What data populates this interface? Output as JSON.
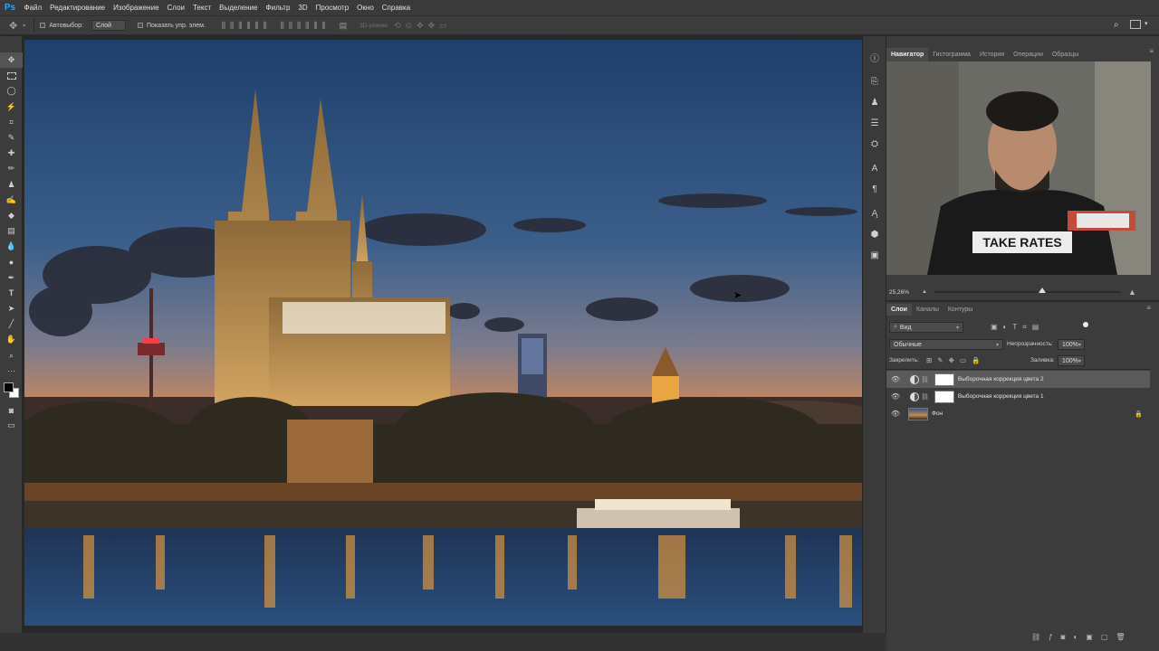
{
  "app": {
    "logo": "Ps"
  },
  "menu": [
    "Файл",
    "Редактирование",
    "Изображение",
    "Слои",
    "Текст",
    "Выделение",
    "Фильтр",
    "3D",
    "Просмотр",
    "Окно",
    "Справка"
  ],
  "options": {
    "autoselect_label": "Автовыбор:",
    "autoselect_value": "Слой",
    "show_controls_label": "Показать упр. элем.",
    "mode3d_label": "3D-режим:"
  },
  "navigator": {
    "tabs": [
      "Навигатор",
      "Гистограмма",
      "История",
      "Операции",
      "Образцы"
    ],
    "zoom": "25,26%",
    "slider_level": 0.58,
    "shirt_text": "TAKE RATES"
  },
  "layers_panel": {
    "tabs": [
      "Слои",
      "Каналы",
      "Контуры"
    ],
    "filter_kind": "Вид",
    "blend_mode": "Обычные",
    "opacity_label": "Непрозрачность:",
    "opacity_value": "100%",
    "lock_label": "Закрепить:",
    "fill_label": "Заливка:",
    "fill_value": "100%",
    "layers": [
      {
        "name": "Выборочная коррекция цвета 2",
        "selected": true
      },
      {
        "name": "Выборочная коррекция цвета 1",
        "selected": false
      },
      {
        "name": "Фон",
        "selected": false
      }
    ]
  },
  "colors": {
    "ps_blue": "#2fa3f7",
    "panel_bg": "#3c3c3c",
    "workspace_bg": "#282828",
    "selected_layer": "#5a5a5a"
  },
  "icons": {
    "tools": [
      "move-icon",
      "marquee-icon",
      "lasso-icon",
      "magic-wand-icon",
      "crop-icon",
      "eyedropper-icon",
      "healing-brush-icon",
      "brush-icon",
      "clone-stamp-icon",
      "history-brush-icon",
      "eraser-icon",
      "gradient-icon",
      "blur-icon",
      "dodge-icon",
      "pen-icon",
      "type-icon",
      "path-select-icon",
      "line-icon",
      "hand-icon",
      "zoom-icon",
      "more-tools-icon"
    ],
    "strip": [
      "info-icon",
      "properties-icon",
      "adjustments-icon",
      "layer-comps-icon",
      "clone-source-icon",
      "character-icon",
      "paragraph-icon",
      "glyphs-icon",
      "3d-icon",
      "libraries-icon"
    ]
  }
}
